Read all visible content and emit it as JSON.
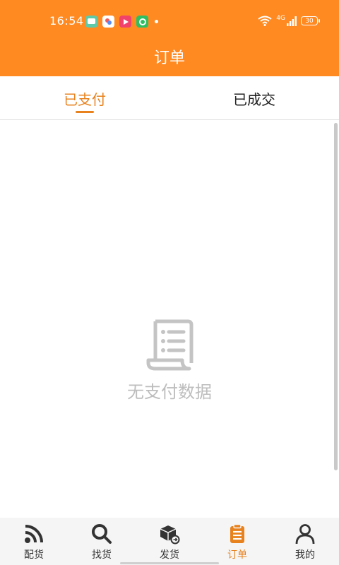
{
  "status_bar": {
    "time": "16:54",
    "network": "4G",
    "battery": "30",
    "notification_icons": [
      "chat-app-icon",
      "photo-app-icon",
      "video-app-icon",
      "s-app-icon"
    ]
  },
  "header": {
    "title": "订单"
  },
  "tabs": [
    {
      "label": "已支付",
      "active": true
    },
    {
      "label": "已成交",
      "active": false
    }
  ],
  "empty_state": {
    "icon": "receipt-icon",
    "text": "无支付数据"
  },
  "bottom_nav": [
    {
      "label": "配货",
      "icon": "rss-icon",
      "active": false
    },
    {
      "label": "找货",
      "icon": "search-icon",
      "active": false
    },
    {
      "label": "发货",
      "icon": "package-icon",
      "active": false
    },
    {
      "label": "订单",
      "icon": "clipboard-icon",
      "active": true
    },
    {
      "label": "我的",
      "icon": "user-icon",
      "active": false
    }
  ],
  "colors": {
    "primary": "#FF8A22",
    "accent": "#E8821E",
    "muted": "#bdbdbd"
  }
}
